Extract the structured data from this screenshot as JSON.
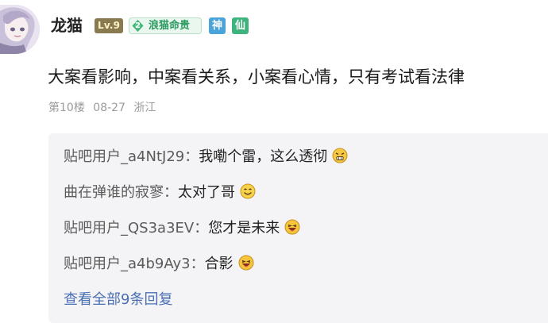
{
  "post": {
    "author": "龙猫",
    "level": "Lv.9",
    "title_badge": {
      "number": "2",
      "label": "浪猫命贵"
    },
    "badges": [
      "神",
      "仙"
    ],
    "content": "大案看影响，中案看关系，小案看心情，只有考试看法律",
    "floor": "第10楼",
    "date": "08-27",
    "location": "浙江"
  },
  "replies": [
    {
      "user": "贴吧用户_a4NtJ29",
      "separator": "：",
      "text": "我嘞个雷，这么透彻",
      "emoji": "grimace-emoji"
    },
    {
      "user": "曲在弹谁的寂寥",
      "separator": "：",
      "text": "太对了哥",
      "emoji": "smile-emoji"
    },
    {
      "user": "贴吧用户_QS3a3EV",
      "separator": "：",
      "text": "您才是未来",
      "emoji": "laugh-emoji"
    },
    {
      "user": "贴吧用户_a4b9Ay3",
      "separator": "：",
      "text": "合影",
      "emoji": "laugh-emoji"
    }
  ],
  "view_all": "查看全部9条回复",
  "colors": {
    "link": "#4a6fb5",
    "meta": "#9b9b9b",
    "reply_background": "#f4f4f6",
    "title_badge": "#2c9b60",
    "god_badge": "#4aa3d9",
    "xian_badge": "#3fb37e"
  }
}
